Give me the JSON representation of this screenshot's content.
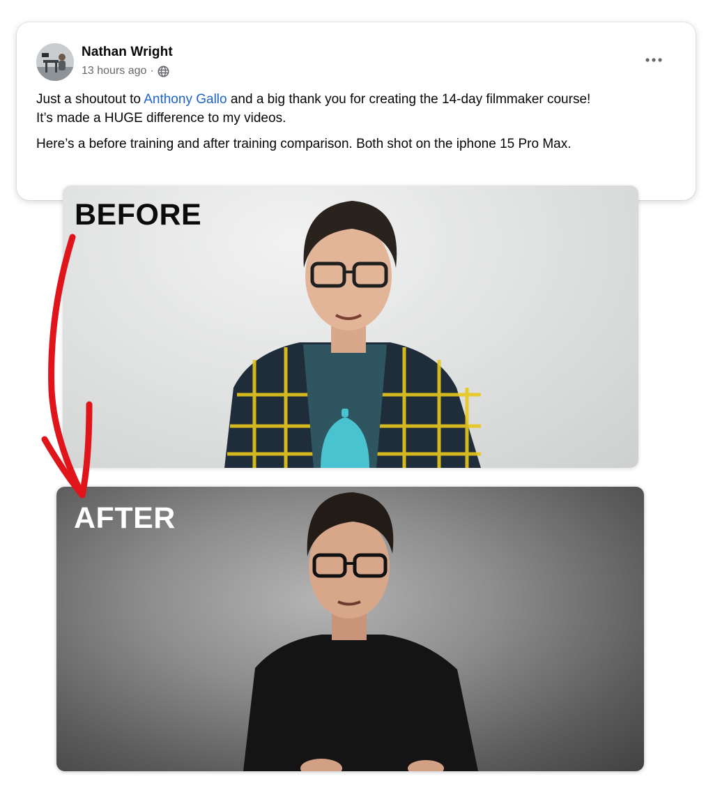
{
  "post": {
    "author": "Nathan Wright",
    "timestamp": "13 hours ago",
    "separator": "·",
    "privacy_icon": "globe-icon",
    "more_icon": "more-horizontal-icon",
    "text": {
      "line1_prefix": "Just a shoutout to ",
      "mention": "Anthony Gallo",
      "line1_suffix": " and a big thank you for creating the 14-day filmmaker course!",
      "line2": "It’s made a HUGE difference to my videos.",
      "line3": "Here’s a before training and after training comparison. Both shot on the iphone 15 Pro Max."
    }
  },
  "images": {
    "before_label": "BEFORE",
    "after_label": "AFTER"
  },
  "colors": {
    "mention_link": "#1b62c9",
    "annotation_arrow": "#e0141b",
    "meta_text": "#65676b"
  }
}
